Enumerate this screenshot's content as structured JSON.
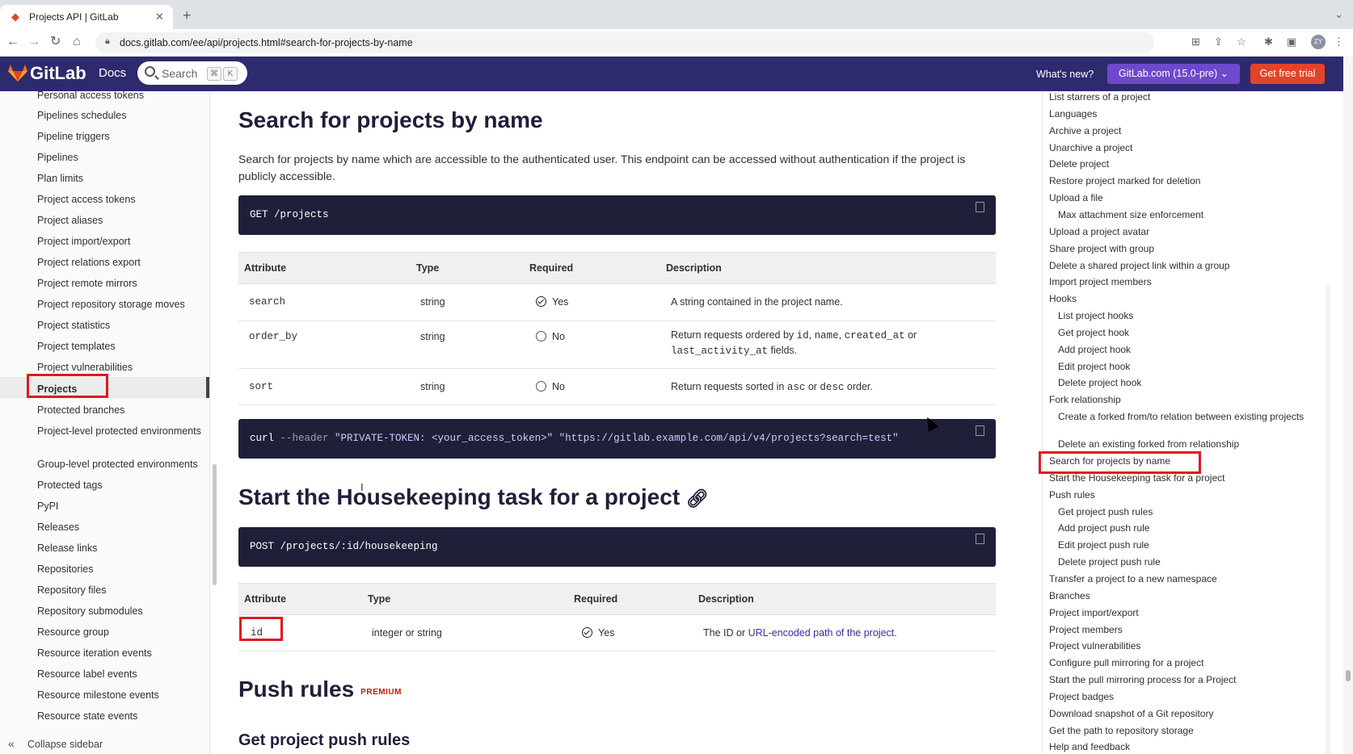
{
  "browser": {
    "tab_title": "Projects API | GitLab",
    "url": "docs.gitlab.com/ee/api/projects.html#search-for-projects-by-name",
    "avatar_initials": "ZY"
  },
  "header": {
    "logo_text": "GitLab",
    "docs_label": "Docs",
    "search_placeholder": "Search",
    "kbd_cmd": "⌘",
    "kbd_k": "K",
    "whats_new": "What's new?",
    "version": "GitLab.com (15.0-pre)",
    "cta": "Get free trial"
  },
  "sidebar": {
    "items": [
      "Personal access tokens",
      "Pipelines schedules",
      "Pipeline triggers",
      "Pipelines",
      "Plan limits",
      "Project access tokens",
      "Project aliases",
      "Project import/export",
      "Project relations export",
      "Project remote mirrors",
      "Project repository storage moves",
      "Project statistics",
      "Project templates",
      "Project vulnerabilities",
      "Projects",
      "Protected branches",
      "Project-level protected environments",
      "Group-level protected environments",
      "Protected tags",
      "PyPI",
      "Releases",
      "Release links",
      "Repositories",
      "Repository files",
      "Repository submodules",
      "Resource group",
      "Resource iteration events",
      "Resource label events",
      "Resource milestone events",
      "Resource state events"
    ],
    "collapse_label": "Collapse sidebar"
  },
  "main": {
    "section1": {
      "title": "Search for projects by name",
      "description": "Search for projects by name which are accessible to the authenticated user. This endpoint can be accessed without authentication if the project is publicly accessible.",
      "endpoint": "GET /projects",
      "headers": [
        "Attribute",
        "Type",
        "Required",
        "Description"
      ],
      "rows": [
        {
          "attr": "search",
          "type": "string",
          "required": "Yes",
          "desc": "A string contained in the project name."
        },
        {
          "attr": "order_by",
          "type": "string",
          "required": "No",
          "desc_a": "Return requests ordered by ",
          "c1": "id",
          "s1": ", ",
          "c2": "name",
          "s2": ", ",
          "c3": "created_at",
          "s3": " or",
          "c4": "last_activity_at",
          "s4": " fields."
        },
        {
          "attr": "sort",
          "type": "string",
          "required": "No",
          "desc_a": "Return requests sorted in ",
          "c1": "asc",
          "s1": " or ",
          "c2": "desc",
          "s2": " order."
        }
      ],
      "curl": {
        "cmd": "curl ",
        "flag": "--header",
        "header_val": " \"PRIVATE-TOKEN: <your_access_token>\"",
        "url": " \"https://gitlab.example.com/api/v4/projects?search=test\""
      }
    },
    "section2": {
      "title": "Start the Housekeeping task for a project",
      "endpoint": "POST /projects/:id/housekeeping",
      "headers": [
        "Attribute",
        "Type",
        "Required",
        "Description"
      ],
      "row": {
        "attr": "id",
        "type": "integer or string",
        "required": "Yes",
        "desc_a": "The ID or ",
        "link": "URL-encoded path of the project",
        "desc_b": "."
      }
    },
    "section3": {
      "title": "Push rules",
      "badge": "PREMIUM",
      "subtitle": "Get project push rules"
    }
  },
  "toc": {
    "items": [
      {
        "label": "List starrers of a project",
        "sub": false
      },
      {
        "label": "Languages",
        "sub": false
      },
      {
        "label": "Archive a project",
        "sub": false
      },
      {
        "label": "Unarchive a project",
        "sub": false
      },
      {
        "label": "Delete project",
        "sub": false
      },
      {
        "label": "Restore project marked for deletion",
        "sub": false
      },
      {
        "label": "Upload a file",
        "sub": false
      },
      {
        "label": "Max attachment size enforcement",
        "sub": true
      },
      {
        "label": "Upload a project avatar",
        "sub": false
      },
      {
        "label": "Share project with group",
        "sub": false
      },
      {
        "label": "Delete a shared project link within a group",
        "sub": false
      },
      {
        "label": "Import project members",
        "sub": false
      },
      {
        "label": "Hooks",
        "sub": false
      },
      {
        "label": "List project hooks",
        "sub": true
      },
      {
        "label": "Get project hook",
        "sub": true
      },
      {
        "label": "Add project hook",
        "sub": true
      },
      {
        "label": "Edit project hook",
        "sub": true
      },
      {
        "label": "Delete project hook",
        "sub": true
      },
      {
        "label": "Fork relationship",
        "sub": false
      },
      {
        "label": "Create a forked from/to relation between existing projects",
        "sub": true
      },
      {
        "label": "Delete an existing forked from relationship",
        "sub": true
      },
      {
        "label": "Search for projects by name",
        "sub": false
      },
      {
        "label": "Start the Housekeeping task for a project",
        "sub": false
      },
      {
        "label": "Push rules",
        "sub": false
      },
      {
        "label": "Get project push rules",
        "sub": true
      },
      {
        "label": "Add project push rule",
        "sub": true
      },
      {
        "label": "Edit project push rule",
        "sub": true
      },
      {
        "label": "Delete project push rule",
        "sub": true
      },
      {
        "label": "Transfer a project to a new namespace",
        "sub": false
      },
      {
        "label": "Branches",
        "sub": false
      },
      {
        "label": "Project import/export",
        "sub": false
      },
      {
        "label": "Project members",
        "sub": false
      },
      {
        "label": "Project vulnerabilities",
        "sub": false
      },
      {
        "label": "Configure pull mirroring for a project",
        "sub": false
      },
      {
        "label": "Start the pull mirroring process for a Project",
        "sub": false
      },
      {
        "label": "Project badges",
        "sub": false
      },
      {
        "label": "Download snapshot of a Git repository",
        "sub": false
      },
      {
        "label": "Get the path to repository storage",
        "sub": false
      },
      {
        "label": "Help and feedback",
        "sub": false
      }
    ]
  },
  "colors": {
    "header_bg": "#2e2a6e",
    "code_bg": "#1f1f3a",
    "version_bg": "#6e49cb",
    "cta_bg": "#e24329",
    "highlight": "#e0191f"
  }
}
